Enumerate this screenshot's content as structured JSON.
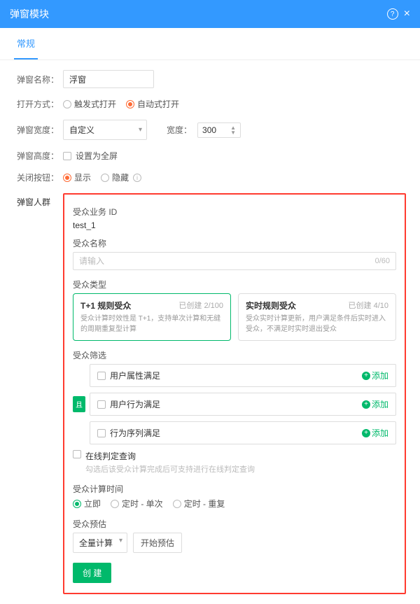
{
  "header": {
    "title": "弹窗模块"
  },
  "tabs": {
    "active": "常规"
  },
  "form": {
    "name_label": "弹窗名称：",
    "name_value": "浮窗",
    "open_label": "打开方式：",
    "open_opts": {
      "trigger": "触发式打开",
      "auto": "自动式打开"
    },
    "width_label": "弹窗宽度：",
    "width_mode": "自定义",
    "width_sub": "宽度：",
    "width_value": "300",
    "height_label": "弹窗高度：",
    "height_full": "设置为全屏",
    "close_label": "关闭按钮：",
    "close_opts": {
      "show": "显示",
      "hide": "隐藏"
    }
  },
  "audience_side_label": "弹窗人群",
  "audience": {
    "bizid_label": "受众业务 ID",
    "bizid_value": "test_1",
    "name_label": "受众名称",
    "name_placeholder": "请输入",
    "name_count": "0/60",
    "type_label": "受众类型",
    "types": [
      {
        "title": "T+1 规则受众",
        "meta": "已创建 2/100",
        "desc": "受众计算时效性是 T+1，支持单次计算和无缝的周期重复型计算"
      },
      {
        "title": "实时规则受众",
        "meta": "已创建 4/10",
        "desc": "受众实时计算更新，用户满足条件后实时进入受众，不满足时实时退出受众"
      }
    ],
    "filter_label": "受众筛选",
    "filters": [
      {
        "label": "用户属性满足",
        "add": "添加"
      },
      {
        "label": "用户行为满足",
        "add": "添加",
        "and": "且"
      },
      {
        "label": "行为序列满足",
        "add": "添加"
      }
    ],
    "online_check": "在线判定查询",
    "online_hint": "勾选后该受众计算完成后可支持进行在线判定查询",
    "calc_label": "受众计算时间",
    "calc_opts": {
      "now": "立即",
      "single": "定时 - 单次",
      "repeat": "定时 - 重复"
    },
    "est_label": "受众预估",
    "est_mode": "全量计算",
    "est_start": "开始预估",
    "create_btn": "创 建"
  }
}
